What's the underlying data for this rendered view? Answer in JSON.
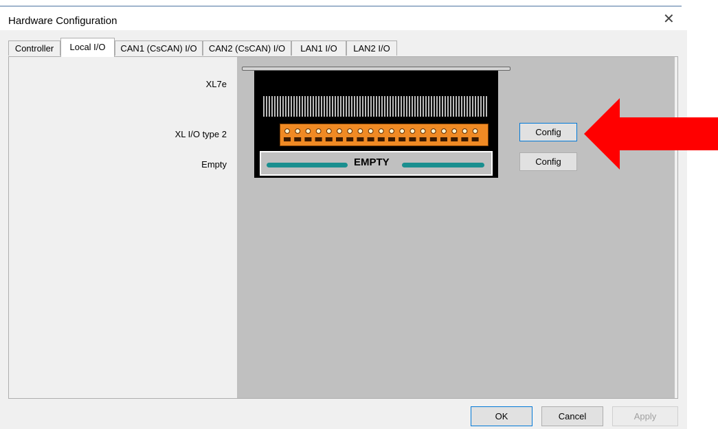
{
  "window": {
    "title": "Hardware Configuration",
    "close_glyph": "✕"
  },
  "tabs": [
    {
      "label": "Controller",
      "active": false
    },
    {
      "label": "Local I/O",
      "active": true
    },
    {
      "label": "CAN1 (CsCAN) I/O",
      "active": false
    },
    {
      "label": "CAN2 (CsCAN) I/O",
      "active": false
    },
    {
      "label": "LAN1 I/O",
      "active": false
    },
    {
      "label": "LAN2 I/O",
      "active": false
    }
  ],
  "rack": {
    "model_label": "XL7e",
    "slots": [
      {
        "label": "XL I/O type 2",
        "config_label": "Config"
      },
      {
        "label": "Empty",
        "config_label": "Config",
        "display_text": "EMPTY"
      }
    ]
  },
  "footer": {
    "ok_label": "OK",
    "cancel_label": "Cancel",
    "apply_label": "Apply"
  },
  "colors": {
    "annotation_arrow": "#ff0000",
    "module": "#f08a24",
    "empty_bar": "#1a8f8f"
  }
}
